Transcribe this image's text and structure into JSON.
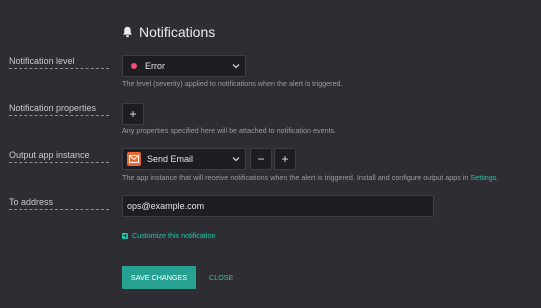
{
  "header": {
    "title": "Notifications",
    "icon": "bell-icon"
  },
  "fields": {
    "level": {
      "label": "Notification level",
      "value": "Error",
      "dot_color": "#ef4f7a",
      "help": "The level (severity) applied to notifications when the alert is triggered."
    },
    "properties": {
      "label": "Notification properties",
      "add_label": "+",
      "help": "Any properties specified here will be attached to notification events."
    },
    "output": {
      "label": "Output app instance",
      "value": "Send Email",
      "icon": "email-app-icon",
      "minus_label": "−",
      "plus_label": "+",
      "help_prefix": "The app instance that will receive notifications when the alert is triggered. Install and configure output apps in ",
      "help_link": "Settings",
      "help_suffix": "."
    },
    "to": {
      "label": "To address",
      "value": "ops@example.com"
    }
  },
  "customize_label": "Customize this notification",
  "actions": {
    "save_label": "SAVE CHANGES",
    "close_label": "CLOSE"
  },
  "colors": {
    "accent": "#26a192",
    "link": "#26c6a8",
    "background": "#2d2d33"
  }
}
